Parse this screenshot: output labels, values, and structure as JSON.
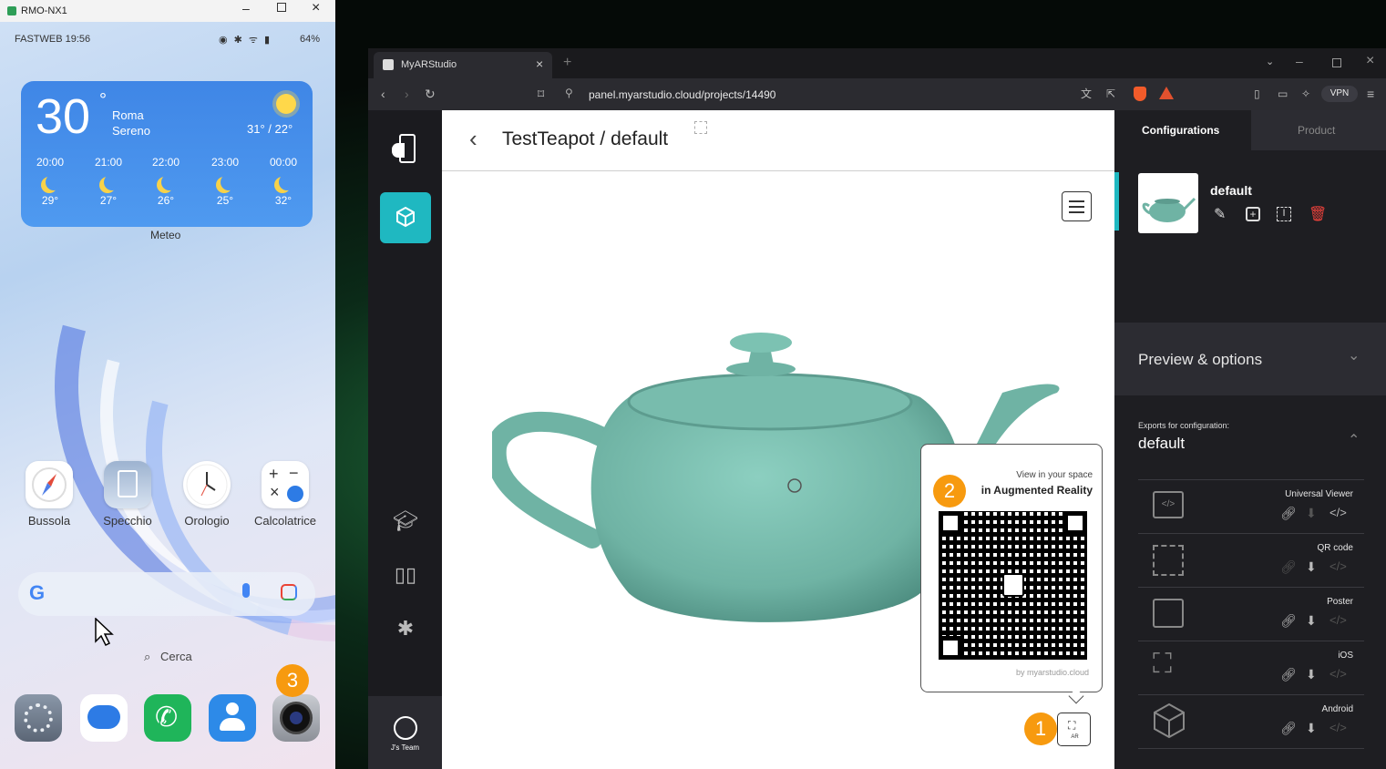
{
  "phone": {
    "window_title": "RMO-NX1",
    "carrier_time": "FASTWEB 19:56",
    "battery": "64%",
    "weather": {
      "temp": "30",
      "degree": "°",
      "city": "Roma",
      "condition": "Sereno",
      "range": "31° / 22°",
      "label": "Meteo",
      "hours": [
        {
          "time": "20:00",
          "temp": "29°"
        },
        {
          "time": "21:00",
          "temp": "27°"
        },
        {
          "time": "22:00",
          "temp": "26°"
        },
        {
          "time": "23:00",
          "temp": "25°"
        },
        {
          "time": "00:00",
          "temp": "32°"
        }
      ]
    },
    "apps": [
      {
        "label": "Bussola",
        "icon": "compass-icon"
      },
      {
        "label": "Specchio",
        "icon": "mirror-icon"
      },
      {
        "label": "Orologio",
        "icon": "clock-icon"
      },
      {
        "label": "Calcolatrice",
        "icon": "calculator-icon"
      }
    ],
    "search_label": "Cerca",
    "dock": [
      "settings-icon",
      "messages-icon",
      "phone-icon",
      "contacts-icon",
      "camera-icon"
    ],
    "badge_3": "3"
  },
  "browser": {
    "tab_title": "MyARStudio",
    "url": "panel.myarstudio.cloud/projects/14490",
    "vpn": "VPN"
  },
  "app": {
    "breadcrumb": "TestTeapot / default",
    "rail_team": "J's Team",
    "ar_popup": {
      "line1": "View in your space",
      "line2": "in Augmented Reality",
      "footer": "by myarstudio.cloud",
      "badge": "2"
    },
    "ar_button_label": "AR",
    "badge_1": "1",
    "colors": {
      "accent": "#1fb8c1",
      "teapot": "#6fb3a4",
      "badge": "#f79a0f"
    }
  },
  "panel": {
    "tabs": [
      "Configurations",
      "Product"
    ],
    "config_name": "default",
    "preview_title": "Preview & options",
    "exports_caption": "Exports for configuration:",
    "exports_config": "default",
    "exports": [
      {
        "label": "Universal Viewer",
        "icon": "code-window-icon"
      },
      {
        "label": "QR code",
        "icon": "qr-icon"
      },
      {
        "label": "Poster",
        "icon": "image-icon"
      },
      {
        "label": "iOS",
        "icon": "ar-cube-icon"
      },
      {
        "label": "Android",
        "icon": "cube-icon"
      }
    ]
  }
}
